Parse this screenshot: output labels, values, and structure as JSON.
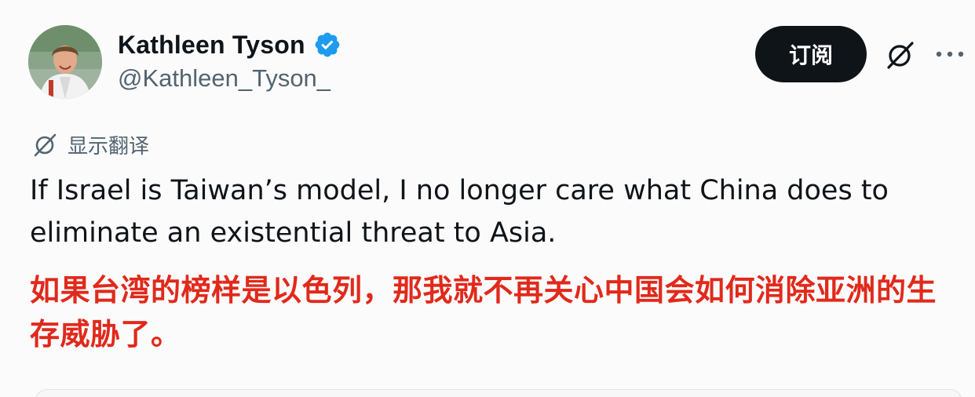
{
  "author": {
    "display_name": "Kathleen Tyson",
    "handle": "@Kathleen_Tyson_",
    "verified": true,
    "verified_color": "#1d9bf0"
  },
  "actions": {
    "subscribe_label": "订阅",
    "grok_icon": "grok-slash-icon",
    "more_icon": "more-dots-icon"
  },
  "translate": {
    "label": "显示翻译",
    "icon": "translate-icon"
  },
  "tweet": {
    "text": "If Israel is Taiwan’s model, I no longer care what China does to eliminate an existential threat to Asia."
  },
  "caption": {
    "text": "如果台湾的榜样是以色列，那我就不再关心中国会如何消除亚洲的生存威胁了。",
    "color": "#e1291b"
  },
  "colors": {
    "text_primary": "#0f1419",
    "text_secondary": "#536471",
    "button_bg": "#0f1419",
    "background": "#fbfbfb"
  }
}
